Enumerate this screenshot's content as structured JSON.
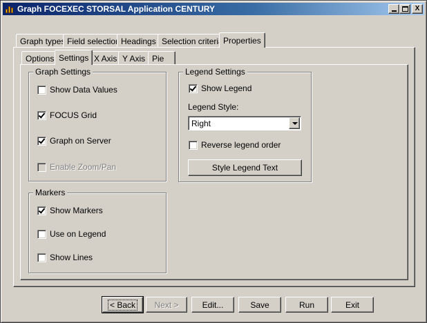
{
  "window": {
    "title": "Graph FOCEXEC STORSAL Application CENTURY",
    "minimize_glyph": "_",
    "maximize_glyph": "□",
    "close_glyph": "X"
  },
  "main_tabs": [
    {
      "label": "Graph types"
    },
    {
      "label": "Field selection"
    },
    {
      "label": "Headings"
    },
    {
      "label": "Selection criteria"
    },
    {
      "label": "Properties"
    }
  ],
  "sub_tabs": [
    {
      "label": "Options"
    },
    {
      "label": "Settings"
    },
    {
      "label": "X Axis"
    },
    {
      "label": "Y Axis"
    },
    {
      "label": "Pie"
    }
  ],
  "graph_settings": {
    "title": "Graph Settings",
    "show_data_values": "Show Data Values",
    "focus_grid": "FOCUS Grid",
    "graph_on_server": "Graph on Server",
    "enable_zoom_pan": "Enable Zoom/Pan"
  },
  "markers": {
    "title": "Markers",
    "show_markers": "Show Markers",
    "use_on_legend": "Use on Legend",
    "show_lines": "Show Lines"
  },
  "legend_settings": {
    "title": "Legend Settings",
    "show_legend": "Show Legend",
    "legend_style_label": "Legend Style:",
    "legend_style_value": "Right",
    "reverse_order": "Reverse legend order",
    "style_text_button": "Style Legend Text"
  },
  "footer": {
    "back": "< Back",
    "next": "Next >",
    "edit": "Edit...",
    "save": "Save",
    "run": "Run",
    "exit": "Exit"
  }
}
